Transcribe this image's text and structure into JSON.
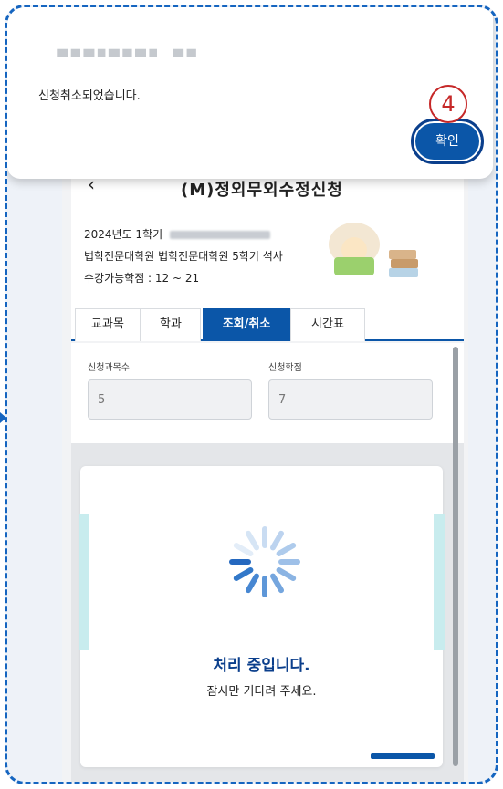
{
  "dialog": {
    "message": "신청취소되었습니다.",
    "ok_label": "확인",
    "step_number": "4"
  },
  "appbar": {
    "back_icon": "chevron-left-icon",
    "title": "(M)정외무외수정신청"
  },
  "info": {
    "term": "2024년도 1학기",
    "program": "법학전문대학원 법학전문대학원 5학기 석사",
    "credits": "수강가능학점 : 12 ~ 21"
  },
  "tabs": [
    {
      "label": "교과목"
    },
    {
      "label": "학과"
    },
    {
      "label": "조회/취소"
    },
    {
      "label": "시간표"
    }
  ],
  "summary": {
    "course_count_label": "신청과목수",
    "course_count": "5",
    "credit_label": "신청학점",
    "credit": "7"
  },
  "loading": {
    "title": "처리 중입니다.",
    "subtitle": "잠시만 기다려 주세요."
  },
  "colors": {
    "accent": "#0b56a8",
    "frame_border": "#1565c0",
    "step_marker": "#c62828"
  }
}
